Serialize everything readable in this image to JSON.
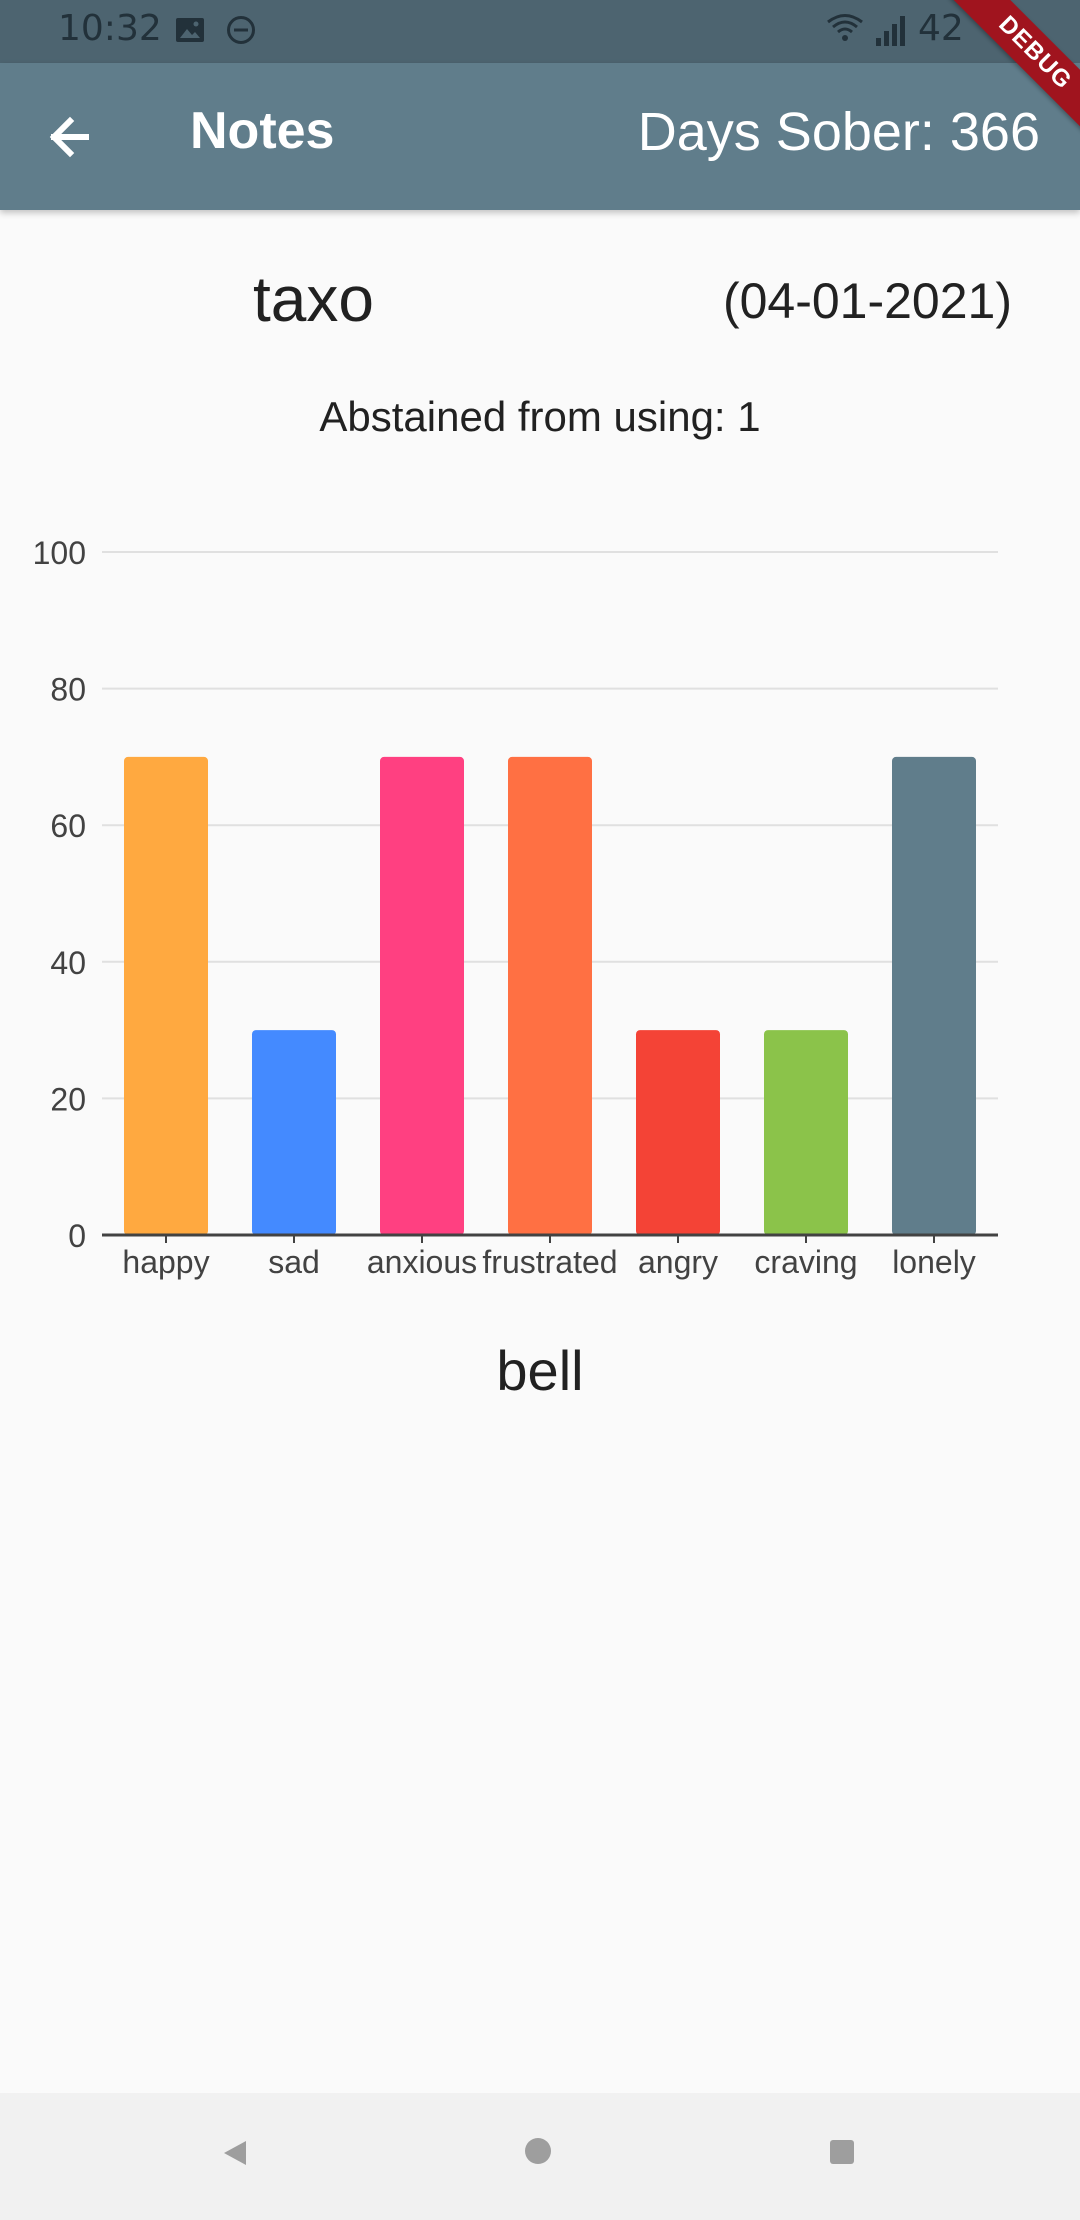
{
  "status_bar": {
    "time": "10:32",
    "battery": "42",
    "icons": [
      "image-icon",
      "do-not-disturb-icon",
      "wifi-icon",
      "signal-icon"
    ]
  },
  "app_bar": {
    "title": "Notes",
    "days_sober": "Days Sober: 366",
    "back_icon": "arrow-back-icon",
    "color": "#607d8b"
  },
  "debug_banner": "DEBUG",
  "note": {
    "title": "taxo",
    "date": "(04-01-2021)",
    "abstained_label": "Abstained from using:",
    "abstained_value": "1",
    "footer": "bell"
  },
  "chart_data": {
    "type": "bar",
    "categories": [
      "happy",
      "sad",
      "anxious",
      "frustrated",
      "angry",
      "craving",
      "lonely"
    ],
    "values": [
      70,
      30,
      70,
      70,
      30,
      30,
      70
    ],
    "colors": [
      "#ffa940",
      "#448aff",
      "#ff4081",
      "#ff7043",
      "#f44336",
      "#8bc34a",
      "#607d8b"
    ],
    "ylim": [
      0,
      100
    ],
    "yticks": [
      0,
      20,
      40,
      60,
      80,
      100
    ],
    "grid": true
  },
  "nav_bar": {
    "icons": [
      "nav-back-icon",
      "nav-home-icon",
      "nav-recents-icon"
    ]
  }
}
